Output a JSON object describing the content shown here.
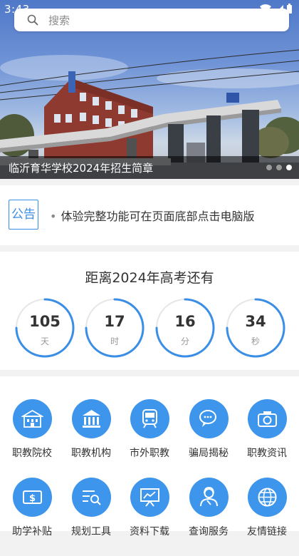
{
  "status": {
    "time": "3:43"
  },
  "search": {
    "placeholder": "搜索"
  },
  "banner": {
    "caption": "临沂育华学校2024年招生简章",
    "slide_count": 3,
    "active_slide": 3
  },
  "notice": {
    "tag": "公告",
    "bullet": "•",
    "text": "体验完整功能可在页面底部点击电脑版"
  },
  "countdown": {
    "title": "距离2024年高考还有",
    "accent": "#3b8ee6",
    "units": [
      {
        "value": "105",
        "label": "天"
      },
      {
        "value": "17",
        "label": "时"
      },
      {
        "value": "16",
        "label": "分"
      },
      {
        "value": "34",
        "label": "秒"
      }
    ]
  },
  "grid": {
    "accent": "#3d95ec",
    "items": [
      {
        "label": "职教院校",
        "icon": "school-building-icon"
      },
      {
        "label": "职教机构",
        "icon": "institution-icon"
      },
      {
        "label": "市外职教",
        "icon": "train-icon"
      },
      {
        "label": "骗局揭秘",
        "icon": "chat-bubbles-icon"
      },
      {
        "label": "职教资讯",
        "icon": "camera-icon"
      },
      {
        "label": "助学补贴",
        "icon": "money-icon"
      },
      {
        "label": "规划工具",
        "icon": "list-search-icon"
      },
      {
        "label": "资料下载",
        "icon": "presentation-icon"
      },
      {
        "label": "查询服务",
        "icon": "support-agent-icon"
      },
      {
        "label": "友情链接",
        "icon": "globe-icon"
      }
    ]
  }
}
